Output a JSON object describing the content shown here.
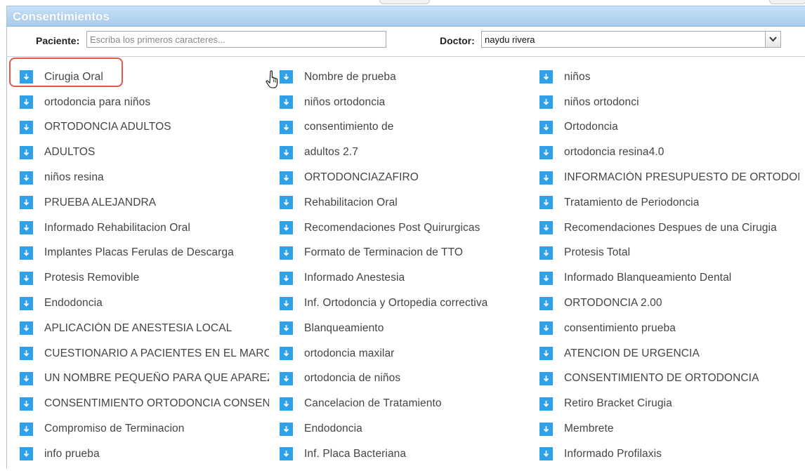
{
  "panel": {
    "title": "Consentimientos",
    "accent": "#2ea1e8",
    "highlight_color": "#e05a48"
  },
  "filters": {
    "paciente_label": "Paciente:",
    "paciente_placeholder": "Escriba los primeros caracteres...",
    "paciente_value": "",
    "doctor_label": "Doctor:",
    "doctor_value": "naydu rivera",
    "doctor_dropdown_icon": "chevron-down-icon"
  },
  "item_icon": "download-icon",
  "highlighted_item": "Cirugia Oral",
  "columns": [
    [
      "Cirugia Oral",
      "ortodoncia para niños",
      "ORTODONCIA ADULTOS",
      "ADULTOS",
      "niños resina",
      "PRUEBA ALEJANDRA",
      "Informado Rehabilitacion Oral",
      "Implantes Placas Ferulas de Descarga",
      "Protesis Removible",
      "Endodoncia",
      "APLICACIÓN DE ANESTESIA LOCAL",
      "CUESTIONARIO A PACIENTES EN EL MARCO",
      "UN NOMBRE PEQUEÑO PARA QUE APAREZCA",
      "CONSENTIMIENTO ORTODONCIA CONSENTIMIENTO",
      "Compromiso de Terminacion",
      "info prueba"
    ],
    [
      "Nombre de prueba",
      "niños ortodoncia",
      "consentimiento de",
      "adultos 2.7",
      "ORTODONCIAZAFIRO",
      "Rehabilitacion Oral",
      "Recomendaciones Post Quirurgicas",
      "Formato de Terminacion de TTO",
      "Informado Anestesia",
      "Inf. Ortodoncia y Ortopedia correctiva",
      "Blanqueamiento",
      "ortodoncia maxilar",
      "ortodoncia de niños",
      "Cancelacion de Tratamiento",
      "Endodoncia",
      "Inf. Placa Bacteriana"
    ],
    [
      "niños",
      "niños ortodonci",
      "Ortodoncia",
      "ortodoncia resina4.0",
      "INFORMACIÓN PRESUPUESTO DE ORTODONCIA",
      "Tratamiento de Periodoncia",
      "Recomendaciones Despues de una Cirugia",
      "Protesis Total",
      "Informado Blanqueamiento Dental",
      "ORTODONCIA 2.00",
      "consentimiento prueba",
      "ATENCION DE URGENCIA",
      "CONSENTIMIENTO DE ORTODONCIA",
      "Retiro Bracket Cirugia",
      "Membrete",
      "Informado Profilaxis"
    ]
  ]
}
